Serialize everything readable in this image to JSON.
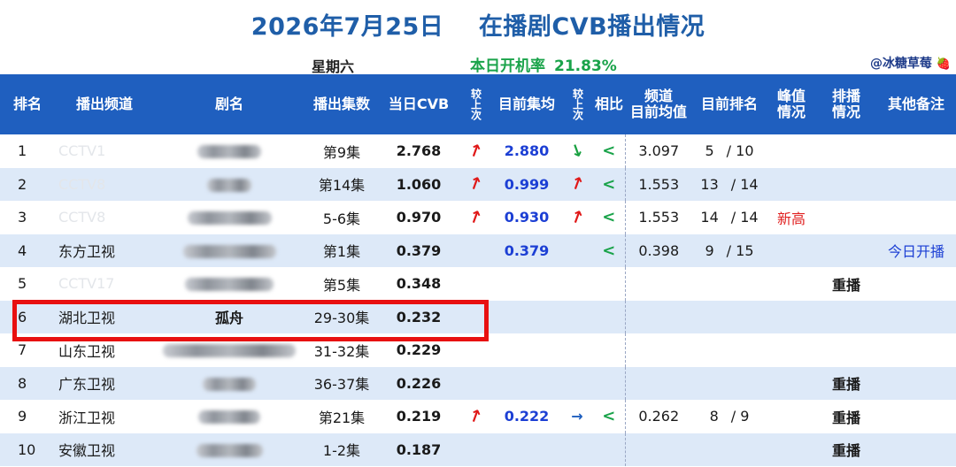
{
  "header": {
    "title": "2026年7月25日    在播剧CVB播出情况",
    "weekday": "星期六",
    "rate_label": "本日开机率",
    "rate_value": "21.83%",
    "author": "@冰糖草莓",
    "author_icon": "strawberry-icon"
  },
  "columns": {
    "rank": "排名",
    "channel": "播出频道",
    "drama": "剧名",
    "episodes": "播出集数",
    "cvb": "当日CVB",
    "vs_prev_1": "较上次",
    "avg": "目前集均",
    "vs_prev_2": "较上次",
    "compare": "相比",
    "channel_avg_line1": "频道",
    "channel_avg_line2": "目前均值",
    "cur_rank": "目前排名",
    "peak_line1": "峰值",
    "peak_line2": "情况",
    "sched_line1": "排播",
    "sched_line2": "情况",
    "notes": "其他备注"
  },
  "rows": [
    {
      "rank": "1",
      "channel": "CCTV1",
      "channel_faded": true,
      "drama": "",
      "drama_blur_w": 72,
      "episodes": "第9集",
      "cvb": "2.768",
      "trend1": "up",
      "avg": "2.880",
      "trend2": "down",
      "compare": "<",
      "channel_avg": "3.097",
      "cur_rank": "5",
      "rank_total": "/ 10",
      "peak": "",
      "sched": "",
      "note": ""
    },
    {
      "rank": "2",
      "channel": "CCTV8",
      "channel_faded": true,
      "drama": "",
      "drama_blur_w": 50,
      "episodes": "第14集",
      "cvb": "1.060",
      "trend1": "up",
      "avg": "0.999",
      "trend2": "up",
      "compare": "<",
      "channel_avg": "1.553",
      "cur_rank": "13",
      "rank_total": "/ 14",
      "peak": "",
      "sched": "",
      "note": ""
    },
    {
      "rank": "3",
      "channel": "CCTV8",
      "channel_faded": true,
      "drama": "",
      "drama_blur_w": 95,
      "episodes": "5-6集",
      "cvb": "0.970",
      "trend1": "up",
      "avg": "0.930",
      "trend2": "up",
      "compare": "<",
      "channel_avg": "1.553",
      "cur_rank": "14",
      "rank_total": "/ 14",
      "peak": "新高",
      "sched": "",
      "note": ""
    },
    {
      "rank": "4",
      "channel": "东方卫视",
      "channel_faded": false,
      "drama": "",
      "drama_blur_w": 105,
      "episodes": "第1集",
      "cvb": "0.379",
      "trend1": "",
      "avg": "0.379",
      "trend2": "",
      "compare": "<",
      "channel_avg": "0.398",
      "cur_rank": "9",
      "rank_total": "/ 15",
      "peak": "",
      "sched": "",
      "note": "今日开播"
    },
    {
      "rank": "5",
      "channel": "CCTV17",
      "channel_faded": true,
      "drama": "",
      "drama_blur_w": 100,
      "episodes": "第5集",
      "cvb": "0.348",
      "trend1": "",
      "avg": "",
      "trend2": "",
      "compare": "",
      "channel_avg": "",
      "cur_rank": "",
      "rank_total": "",
      "peak": "",
      "sched": "重播",
      "note": ""
    },
    {
      "rank": "6",
      "channel": "湖北卫视",
      "channel_faded": false,
      "drama": "孤舟",
      "drama_blur_w": 0,
      "episodes": "29-30集",
      "cvb": "0.232",
      "trend1": "",
      "avg": "",
      "trend2": "",
      "compare": "",
      "channel_avg": "",
      "cur_rank": "",
      "rank_total": "",
      "peak": "",
      "sched": "",
      "note": ""
    },
    {
      "rank": "7",
      "channel": "山东卫视",
      "channel_faded": false,
      "drama": "",
      "drama_blur_w": 150,
      "episodes": "31-32集",
      "cvb": "0.229",
      "trend1": "",
      "avg": "",
      "trend2": "",
      "compare": "",
      "channel_avg": "",
      "cur_rank": "",
      "rank_total": "",
      "peak": "",
      "sched": "",
      "note": ""
    },
    {
      "rank": "8",
      "channel": "广东卫视",
      "channel_faded": false,
      "drama": "",
      "drama_blur_w": 60,
      "episodes": "36-37集",
      "cvb": "0.226",
      "trend1": "",
      "avg": "",
      "trend2": "",
      "compare": "",
      "channel_avg": "",
      "cur_rank": "",
      "rank_total": "",
      "peak": "",
      "sched": "重播",
      "note": ""
    },
    {
      "rank": "9",
      "channel": "浙江卫视",
      "channel_faded": false,
      "drama": "",
      "drama_blur_w": 70,
      "episodes": "第21集",
      "cvb": "0.219",
      "trend1": "up",
      "avg": "0.222",
      "trend2": "flat",
      "compare": "<",
      "channel_avg": "0.262",
      "cur_rank": "8",
      "rank_total": "/ 9",
      "peak": "",
      "sched": "重播",
      "note": ""
    },
    {
      "rank": "10",
      "channel": "安徽卫视",
      "channel_faded": false,
      "drama": "",
      "drama_blur_w": 75,
      "episodes": "1-2集",
      "cvb": "0.187",
      "trend1": "",
      "avg": "",
      "trend2": "",
      "compare": "",
      "channel_avg": "",
      "cur_rank": "",
      "rank_total": "",
      "peak": "",
      "sched": "重播",
      "note": ""
    }
  ],
  "highlight": {
    "row_rank": "6",
    "color": "#e81010"
  },
  "colors": {
    "header_bg": "#1f5fbf",
    "title": "#1f5ea8",
    "rate": "#1aa34a",
    "stripe": "#dde9f8",
    "up": "#e01818",
    "down": "#18a040"
  }
}
